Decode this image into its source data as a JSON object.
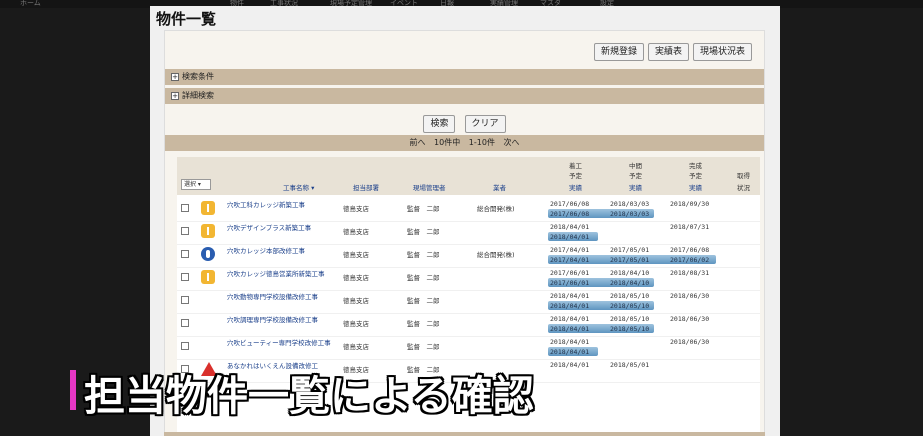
{
  "topnav": [
    "ホーム",
    "物件",
    "工事状況",
    "現場予定管理",
    "イベント",
    "日報",
    "実績管理",
    "マスタ",
    "設定"
  ],
  "title": "物件一覧",
  "buttons": {
    "new": "新規登録",
    "results": "実績表",
    "site_status": "現場状況表"
  },
  "search_conditions": "検索条件",
  "detail_search": "詳細検索",
  "search_btn": "検索",
  "clear_btn": "クリア",
  "pager": {
    "prev": "前へ",
    "count": "10件中",
    "range": "1-10件",
    "next": "次へ"
  },
  "headers": {
    "select": "選択 ▾",
    "name": "工事名称 ▾",
    "dept": "担当部署",
    "mgr": "現場管理者",
    "biz": "業者",
    "start": [
      "着工",
      "予定",
      "実績"
    ],
    "mid": [
      "中間",
      "予定",
      "実績"
    ],
    "done": [
      "完成",
      "予定",
      "実績"
    ],
    "acq": [
      "取得",
      "状況"
    ]
  },
  "rows": [
    {
      "icon": "yellow-person-icon",
      "name": "穴吹工科カレッジ新築工事",
      "dept": "徳島支店",
      "mgr": "監督　二郎",
      "biz": "総合開発(株)",
      "start_plan": "2017/06/08",
      "start_act": "2017/06/08",
      "mid_plan": "2018/03/03",
      "mid_act": "2018/03/03",
      "done_plan": "2018/09/30",
      "done_act": "",
      "bar": [
        0.0,
        0.63
      ]
    },
    {
      "icon": "yellow-person-icon",
      "name": "穴吹デザインプラス新築工事",
      "dept": "徳島支店",
      "mgr": "監督　二郎",
      "biz": "",
      "start_plan": "2018/04/01",
      "start_act": "2018/04/01",
      "mid_plan": "",
      "mid_act": "",
      "done_plan": "2018/07/31",
      "done_act": "",
      "bar": [
        0.0,
        0.3
      ]
    },
    {
      "icon": "blue-person-icon",
      "name": "穴吹カレッジ本部改修工事",
      "dept": "徳島支店",
      "mgr": "監督　二郎",
      "biz": "総合開発(株)",
      "start_plan": "2017/04/01",
      "start_act": "2017/04/01",
      "mid_plan": "2017/05/01",
      "mid_act": "2017/05/01",
      "done_plan": "2017/06/08",
      "done_act": "2017/06/02",
      "bar": [
        0.0,
        1.0
      ]
    },
    {
      "icon": "yellow-person-icon",
      "name": "穴吹カレッジ徳島営業所新築工事",
      "dept": "徳島支店",
      "mgr": "監督　二郎",
      "biz": "",
      "start_plan": "2017/06/01",
      "start_act": "2017/06/01",
      "mid_plan": "2018/04/10",
      "mid_act": "2018/04/10",
      "done_plan": "2018/08/31",
      "done_act": "",
      "bar": [
        0.0,
        0.63
      ]
    },
    {
      "icon": "",
      "name": "穴吹動物専門学校設備改修工事",
      "dept": "徳島支店",
      "mgr": "監督　二郎",
      "biz": "",
      "start_plan": "2018/04/01",
      "start_act": "2018/04/01",
      "mid_plan": "2018/05/10",
      "mid_act": "2018/05/10",
      "done_plan": "2018/06/30",
      "done_act": "",
      "bar": [
        0.0,
        0.63
      ]
    },
    {
      "icon": "",
      "name": "穴吹調理専門学校設備改修工事",
      "dept": "徳島支店",
      "mgr": "監督　二郎",
      "biz": "",
      "start_plan": "2018/04/01",
      "start_act": "2018/04/01",
      "mid_plan": "2018/05/10",
      "mid_act": "2018/05/10",
      "done_plan": "2018/06/30",
      "done_act": "",
      "bar": [
        0.0,
        0.63
      ]
    },
    {
      "icon": "",
      "name": "穴吹ビューティー専門学校改修工事",
      "dept": "徳島支店",
      "mgr": "監督　二郎",
      "biz": "",
      "start_plan": "2018/04/01",
      "start_act": "2018/04/01",
      "mid_plan": "",
      "mid_act": "",
      "done_plan": "2018/06/30",
      "done_act": "",
      "bar": [
        0.0,
        0.3
      ]
    },
    {
      "icon": "warning-icon",
      "name": "あなかれはいくえん設備改修工",
      "dept": "徳島支店",
      "mgr": "監督　二郎",
      "biz": "",
      "start_plan": "2018/04/01",
      "start_act": "",
      "mid_plan": "2018/05/01",
      "mid_act": "",
      "done_plan": "",
      "done_act": "",
      "bar": [
        0.0,
        0.0
      ]
    }
  ],
  "caption": "担当物件一覧による確認"
}
